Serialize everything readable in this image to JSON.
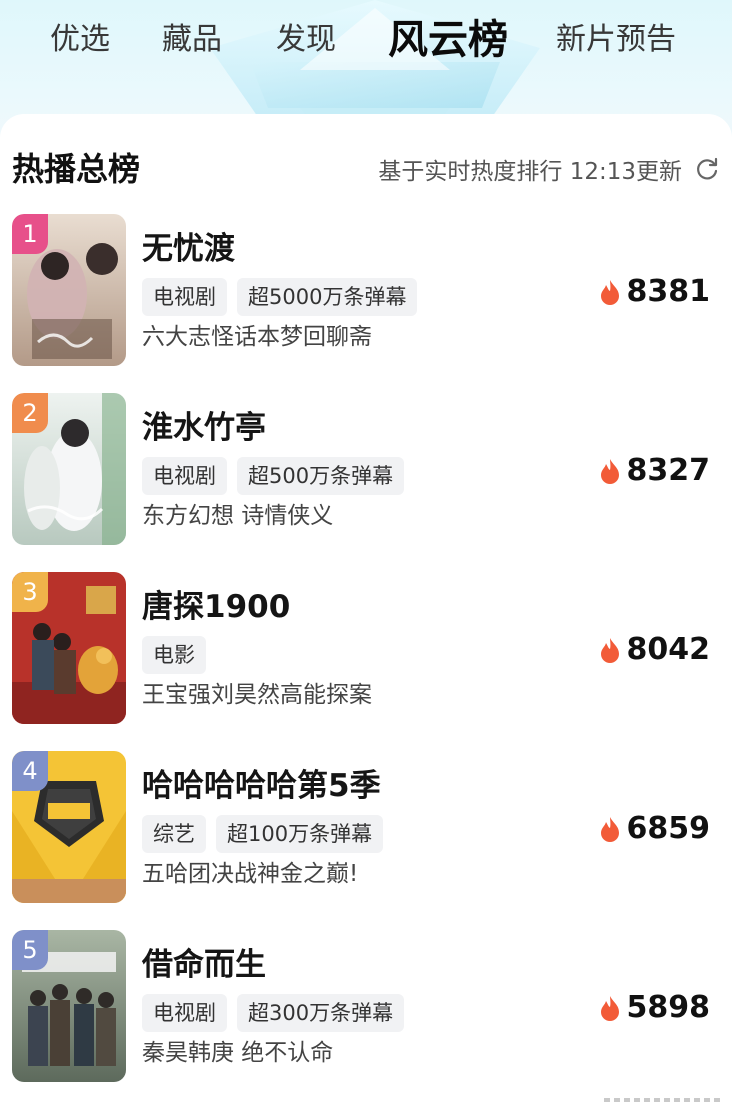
{
  "tabs": [
    {
      "label": "优选"
    },
    {
      "label": "藏品"
    },
    {
      "label": "发现"
    },
    {
      "label": "风云榜",
      "active": true
    },
    {
      "label": "新片预告"
    }
  ],
  "section": {
    "title": "热播总榜",
    "update_text": "基于实时热度排行 12:13更新"
  },
  "icons": {
    "refresh": "refresh-icon",
    "flame": "flame-icon"
  },
  "colors": {
    "rank_1": "#e7508a",
    "rank_2": "#f08c4d",
    "rank_3": "#f0b34a",
    "rank_4": "#7f90c9",
    "rank_5": "#7f90c9",
    "flame": "#f25b38",
    "tag_bg": "#f1f2f4"
  },
  "items": [
    {
      "rank": "1",
      "title": "无忧渡",
      "tags": [
        "电视剧",
        "超5000万条弹幕"
      ],
      "desc": "六大志怪话本梦回聊斋",
      "heat": "8381"
    },
    {
      "rank": "2",
      "title": "淮水竹亭",
      "tags": [
        "电视剧",
        "超500万条弹幕"
      ],
      "desc": "东方幻想 诗情侠义",
      "heat": "8327"
    },
    {
      "rank": "3",
      "title": "唐探1900",
      "tags": [
        "电影"
      ],
      "desc": "王宝强刘昊然高能探案",
      "heat": "8042"
    },
    {
      "rank": "4",
      "title": "哈哈哈哈哈第5季",
      "tags": [
        "综艺",
        "超100万条弹幕"
      ],
      "desc": "五哈团决战神金之巅!",
      "heat": "6859"
    },
    {
      "rank": "5",
      "title": "借命而生",
      "tags": [
        "电视剧",
        "超300万条弹幕"
      ],
      "desc": "秦昊韩庚 绝不认命",
      "heat": "5898"
    }
  ]
}
